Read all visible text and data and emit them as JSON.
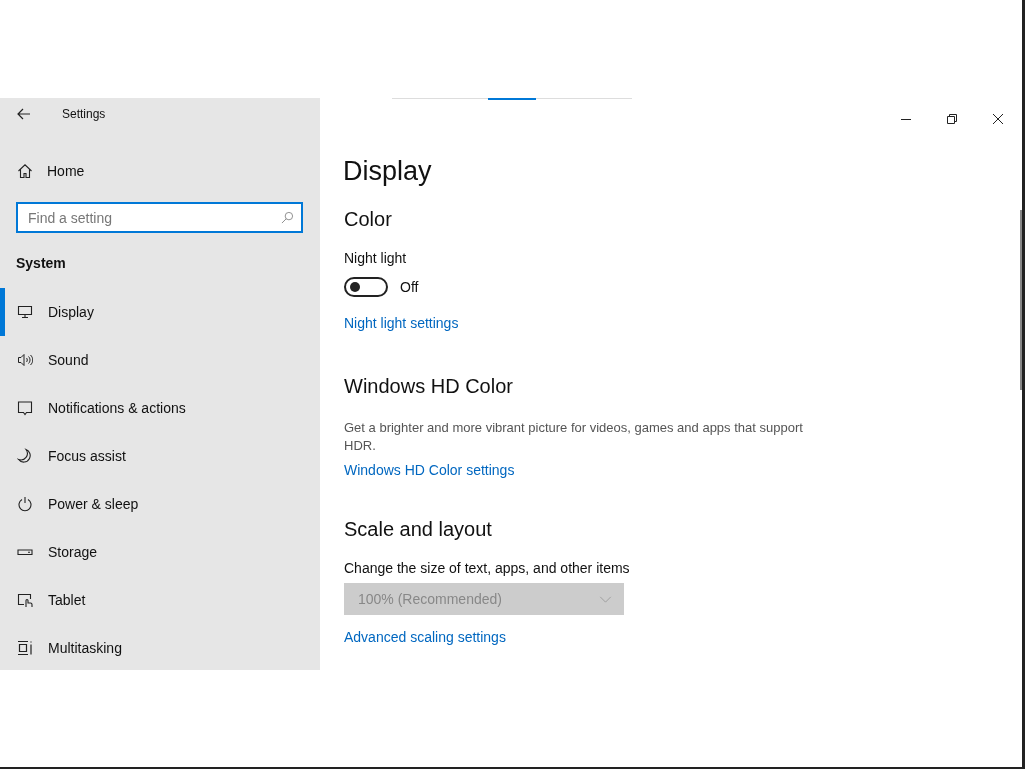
{
  "window": {
    "title": "Settings"
  },
  "sidebar": {
    "home": "Home",
    "search": {
      "placeholder": "Find a setting"
    },
    "section": "System",
    "items": [
      {
        "label": "Display",
        "kind": "display",
        "selected": true
      },
      {
        "label": "Sound",
        "kind": "sound",
        "selected": false
      },
      {
        "label": "Notifications & actions",
        "kind": "notifications",
        "selected": false
      },
      {
        "label": "Focus assist",
        "kind": "moon",
        "selected": false
      },
      {
        "label": "Power & sleep",
        "kind": "power",
        "selected": false
      },
      {
        "label": "Storage",
        "kind": "storage",
        "selected": false
      },
      {
        "label": "Tablet",
        "kind": "tablet",
        "selected": false
      },
      {
        "label": "Multitasking",
        "kind": "multitasking",
        "selected": false
      }
    ]
  },
  "content": {
    "title": "Display",
    "color": {
      "heading": "Color",
      "night_light": {
        "label": "Night light",
        "on": false,
        "state_text": "Off"
      },
      "link": "Night light settings"
    },
    "hd_color": {
      "heading": "Windows HD Color",
      "description": "Get a brighter and more vibrant picture for videos, games and apps that support HDR.",
      "link": "Windows HD Color settings"
    },
    "scale": {
      "heading": "Scale and layout",
      "label": "Change the size of text, apps, and other items",
      "dropdown": {
        "value": "100% (Recommended)",
        "disabled": true
      },
      "link": "Advanced scaling settings"
    }
  }
}
